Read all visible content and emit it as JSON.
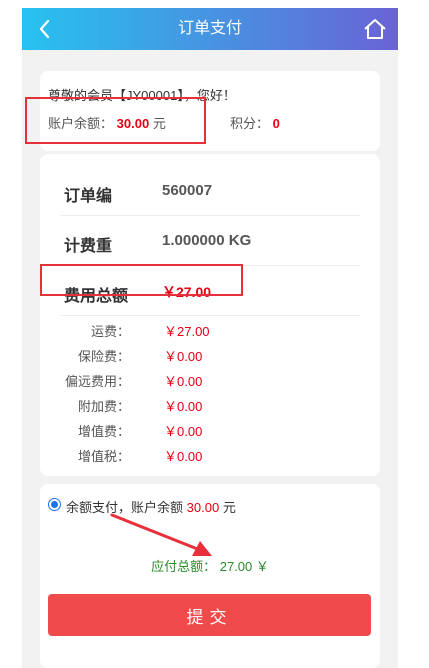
{
  "header": {
    "title": "订单支付",
    "back_icon": "chevron-left-icon",
    "home_icon": "home-icon",
    "gradient": [
      "#27c2f0",
      "#6a63d6"
    ]
  },
  "greeting": {
    "prefix": "尊敬的会员【",
    "member_id": "JY00001",
    "suffix": "】，您好！",
    "balance_label": "账户余额：",
    "balance_value": "30.00",
    "balance_unit": "元",
    "points_label": "积分：",
    "points_value": "0"
  },
  "order": {
    "order_no_label": "订单编",
    "order_no_value": "560007",
    "weight_label": "计费重",
    "weight_value": "1.000000 KG",
    "total_label": "费用总额",
    "total_value": "￥27.00"
  },
  "fees": [
    {
      "label": "运费：",
      "value": "￥27.00"
    },
    {
      "label": "保险费：",
      "value": "￥0.00"
    },
    {
      "label": "偏远费用：",
      "value": "￥0.00"
    },
    {
      "label": "附加费：",
      "value": "￥0.00"
    },
    {
      "label": "增值费：",
      "value": "￥0.00"
    },
    {
      "label": "增值税：",
      "value": "￥0.00"
    }
  ],
  "payment": {
    "option_text": "余额支付，账户余额",
    "option_amount": "30.00",
    "option_unit": "元",
    "payable_label": "应付总额：",
    "payable_value": "27.00 ￥",
    "submit_label": "提交"
  },
  "colors": {
    "accent_red": "#e60012",
    "button_red": "#f04b4b",
    "highlight_box": "#e8303a",
    "payable_green": "#2a8a2a"
  }
}
